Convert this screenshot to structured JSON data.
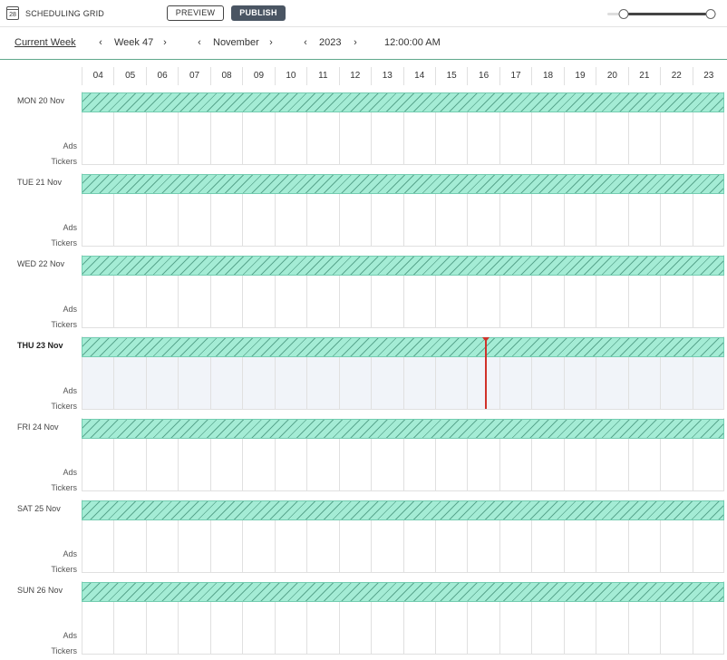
{
  "app": {
    "title": "SCHEDULING GRID",
    "icon_day": "28"
  },
  "toolbar": {
    "preview_label": "PREVIEW",
    "publish_label": "PUBLISH"
  },
  "zoom": {
    "low": 0.15,
    "high": 0.95
  },
  "nav": {
    "current_week_label": "Current Week",
    "week": "Week 47",
    "month": "November",
    "year": "2023",
    "time": "12:00:00 AM",
    "prev_icon": "chevron-left-icon",
    "next_icon": "chevron-right-icon"
  },
  "hours": [
    "04",
    "05",
    "06",
    "07",
    "08",
    "09",
    "10",
    "11",
    "12",
    "13",
    "14",
    "15",
    "16",
    "17",
    "18",
    "19",
    "20",
    "21",
    "22",
    "23"
  ],
  "lanes": {
    "ads": "Ads",
    "tickers": "Tickers"
  },
  "days": [
    {
      "label": "MON 20 Nov",
      "today": false
    },
    {
      "label": "TUE 21 Nov",
      "today": false
    },
    {
      "label": "WED 22 Nov",
      "today": false
    },
    {
      "label": "THU 23 Nov",
      "today": true
    },
    {
      "label": "FRI 24 Nov",
      "today": false
    },
    {
      "label": "SAT 25 Nov",
      "today": false
    },
    {
      "label": "SUN 26 Nov",
      "today": false
    }
  ],
  "colors": {
    "block_fill": "#a4ecd5",
    "block_hatch": "#1e6e55",
    "now_line": "#d0322a",
    "publish_bg": "#4a5563",
    "today_bg": "#f1f4f9"
  }
}
